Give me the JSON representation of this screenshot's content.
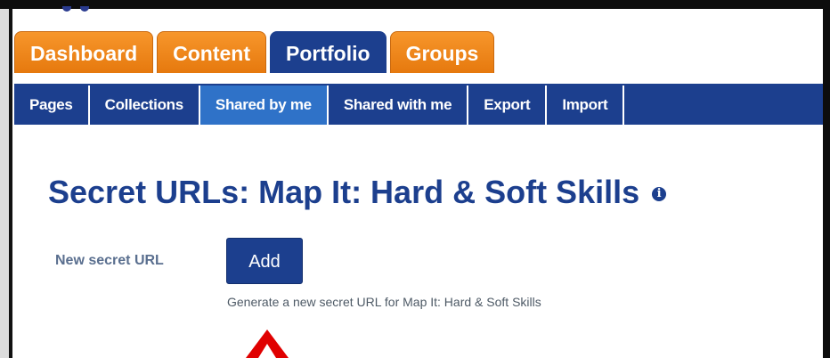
{
  "main_tabs": [
    {
      "label": "Dashboard",
      "active": false
    },
    {
      "label": "Content",
      "active": false
    },
    {
      "label": "Portfolio",
      "active": true
    },
    {
      "label": "Groups",
      "active": false
    }
  ],
  "sub_tabs": [
    {
      "label": "Pages",
      "active": false
    },
    {
      "label": "Collections",
      "active": false
    },
    {
      "label": "Shared by me",
      "active": true
    },
    {
      "label": "Shared with me",
      "active": false
    },
    {
      "label": "Export",
      "active": false
    },
    {
      "label": "Import",
      "active": false
    }
  ],
  "page_title": "Secret URLs: Map It: Hard & Soft Skills",
  "info_icon": {
    "glyph": "i",
    "icon": "info-icon"
  },
  "form": {
    "label": "New secret URL",
    "add_button": "Add",
    "help": "Generate a new secret URL for Map It: Hard & Soft Skills"
  },
  "colors": {
    "primary": "#1c3f8e",
    "tab_orange": "#f7962b",
    "active_subtab": "#2f72c8",
    "annotation_arrow": "#e00000"
  }
}
